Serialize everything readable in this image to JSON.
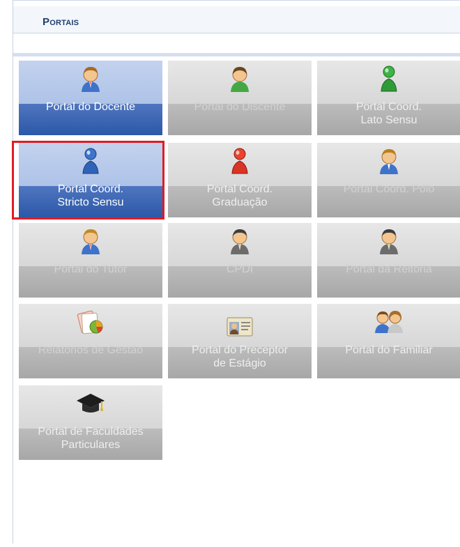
{
  "header": {
    "title": "Portais"
  },
  "portals": [
    {
      "label": "Portal do Docente",
      "icon": "teacher-icon",
      "state": "active"
    },
    {
      "label": "Portal do Discente",
      "icon": "student-icon",
      "state": "disabled"
    },
    {
      "label": "Portal Coord.\nLato Sensu",
      "icon": "green-pawn-icon",
      "state": "enabled"
    },
    {
      "label": "Portal Coord.\nStricto Sensu",
      "icon": "blue-pawn-icon",
      "state": "active",
      "selected": true
    },
    {
      "label": "Portal Coord.\nGraduação",
      "icon": "red-pawn-icon",
      "state": "enabled"
    },
    {
      "label": "Portal Coord. Pólo",
      "icon": "coordinator-icon",
      "state": "disabled"
    },
    {
      "label": "Portal do Tutor",
      "icon": "tutor-icon",
      "state": "disabled"
    },
    {
      "label": "CPDI",
      "icon": "manager-icon",
      "state": "disabled"
    },
    {
      "label": "Portal da Reitoria",
      "icon": "rector-icon",
      "state": "disabled"
    },
    {
      "label": "Relatórios de Gestão",
      "icon": "reports-icon",
      "state": "disabled"
    },
    {
      "label": "Portal do Preceptor\nde Estágio",
      "icon": "preceptor-card-icon",
      "state": "enabled"
    },
    {
      "label": "Portal do Familiar",
      "icon": "family-icon",
      "state": "enabled"
    },
    {
      "label": "Portal de Faculdades\nParticulares",
      "icon": "graduation-cap-icon",
      "state": "enabled"
    }
  ],
  "colors": {
    "active_tile": "#2c58a8",
    "inactive_tile": "#a7a7a7",
    "selection_border": "#e21b23",
    "header_text": "#1f3f6e"
  }
}
